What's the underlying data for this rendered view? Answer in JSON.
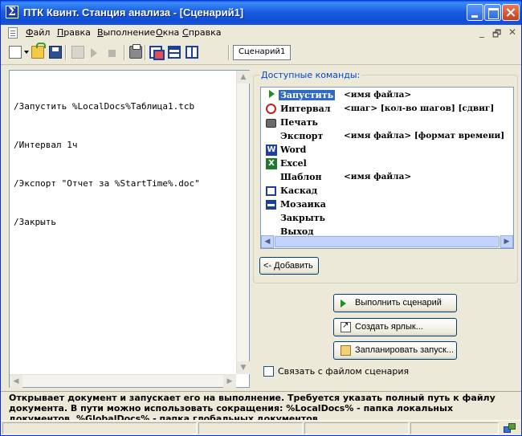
{
  "window": {
    "title": "ПТК Квинт. Станция анализа - [Сценарий1]",
    "title_icon": "Σ",
    "title_icon_name": "sigma-app-icon",
    "colors": {
      "titlebar": "#0a5fe8",
      "selection": "#316ac5",
      "group_label": "#0046d5"
    }
  },
  "menu": {
    "items": [
      {
        "label": "Файл",
        "accel": "Ф",
        "rest": "айл"
      },
      {
        "label": "Правка",
        "accel": "П",
        "rest": "равка"
      },
      {
        "label": "Выполнение",
        "accel": "В",
        "rest": "ыполнение"
      },
      {
        "label": "Окна",
        "accel": "О",
        "rest": "кна"
      },
      {
        "label": "Справка",
        "accel": "С",
        "rest": "правка"
      }
    ],
    "mdi_controls": [
      "_",
      "🗗",
      "✕"
    ]
  },
  "toolbar": {
    "icons": [
      "new-document-icon",
      "dropdown-arrow-icon",
      "open-folder-icon",
      "save-icon",
      "properties-icon",
      "run-icon",
      "stop-icon",
      "print-icon",
      "cascade-icon",
      "tile-horizontal-icon",
      "tile-vertical-icon"
    ],
    "document_tab": "Сценарий1"
  },
  "editor": {
    "lines": [
      "/Запустить %LocalDocs%Таблица1.tcb",
      "/Интервал 1ч",
      "/Экспорт \"Отчет за %StartTime%.doc\"",
      "/Закрыть"
    ]
  },
  "commands": {
    "group_label": "Доступные команды:",
    "selected_index": 0,
    "items": [
      {
        "name": "Запустить",
        "args": "<имя файла>",
        "icon": "play-icon"
      },
      {
        "name": "Интервал",
        "args": "<шаг> [кол-во шагов] [сдвиг]",
        "icon": "clock-icon"
      },
      {
        "name": "Печать",
        "args": "",
        "icon": "print-icon"
      },
      {
        "name": "Экспорт",
        "args": "<имя файла> [формат времени]",
        "icon": ""
      },
      {
        "name": "Word",
        "args": "",
        "icon": "word-icon"
      },
      {
        "name": "Excel",
        "args": "",
        "icon": "excel-icon"
      },
      {
        "name": "Шаблон",
        "args": "<имя файла>",
        "icon": ""
      },
      {
        "name": "Каскад",
        "args": "",
        "icon": "cascade-icon"
      },
      {
        "name": "Мозаика",
        "args": "",
        "icon": "tile-icon"
      },
      {
        "name": "Закрыть",
        "args": "",
        "icon": ""
      },
      {
        "name": "Выход",
        "args": "",
        "icon": ""
      }
    ],
    "add_button": "<- Добавить"
  },
  "actions": {
    "run_label": "Выполнить сценарий",
    "shortcut_label": "Создать ярлык...",
    "schedule_label": "Запланировать запуск..."
  },
  "link_checkbox": {
    "label": "Связать с файлом сценария",
    "checked": false
  },
  "hint": {
    "text": "Открывает документ и запускает его на выполнение. Требуется указать полный путь к файлу документа. В пути можно использовать сокращения: %LocalDocs% - папка локальных документов, %GlobalDocs% - папка глобальных документов"
  }
}
